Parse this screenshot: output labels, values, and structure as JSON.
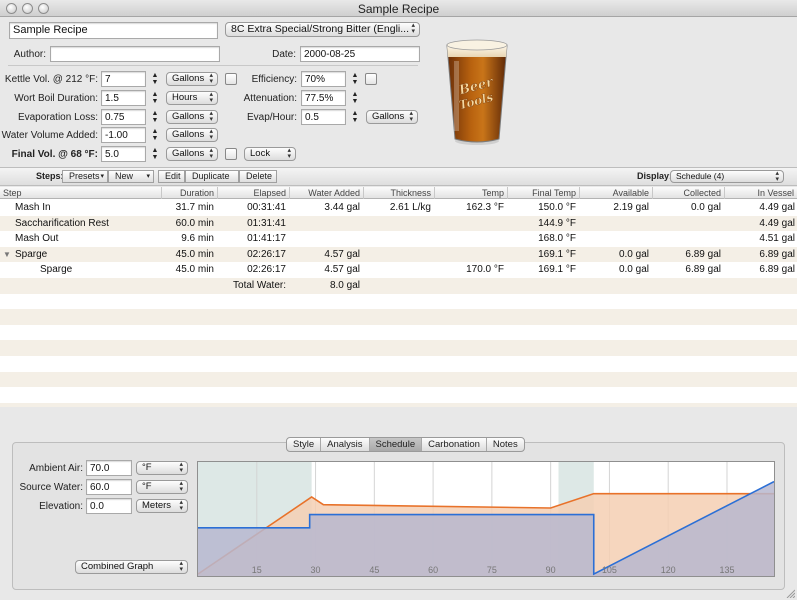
{
  "window": {
    "title": "Sample Recipe"
  },
  "recipe": {
    "name": "Sample Recipe",
    "style": "8C Extra Special/Strong Bitter (Engli...",
    "author_label": "Author:",
    "author": "",
    "date_label": "Date:",
    "date": "2000-08-25"
  },
  "form": {
    "kettle_label": "Kettle Vol. @ 212 °F:",
    "kettle_value": "7",
    "kettle_unit": "Gallons",
    "boil_label": "Wort Boil Duration:",
    "boil_value": "1.5",
    "boil_unit": "Hours",
    "evap_loss_label": "Evaporation Loss:",
    "evap_loss_value": "0.75",
    "evap_loss_unit": "Gallons",
    "water_added_label": "Water Volume Added:",
    "water_added_value": "-1.00",
    "water_added_unit": "Gallons",
    "final_label": "Final Vol. @ 68 °F:",
    "final_value": "5.0",
    "final_unit": "Gallons",
    "lock_label": "Lock",
    "efficiency_label": "Efficiency:",
    "efficiency_value": "70%",
    "attenuation_label": "Attenuation:",
    "attenuation_value": "77.5%",
    "evap_hour_label": "Evap/Hour:",
    "evap_hour_value": "0.5",
    "evap_hour_unit": "Gallons"
  },
  "steps_bar": {
    "steps_label": "Steps:",
    "presets": "Presets",
    "new": "New",
    "edit": "Edit",
    "duplicate": "Duplicate",
    "delete": "Delete",
    "display_label": "Display:",
    "display_value": "Schedule (4)"
  },
  "table": {
    "columns": [
      "Step",
      "Duration",
      "Elapsed",
      "Water Added",
      "Thickness",
      "Temp",
      "Final Temp",
      "Available",
      "Collected",
      "In Vessel"
    ],
    "rows": [
      {
        "step": "Mash In",
        "duration": "31.7 min",
        "elapsed": "00:31:41",
        "water": "3.44 gal",
        "thickness": "2.61 L/kg",
        "temp": "162.3 °F",
        "final": "150.0 °F",
        "available": "2.19 gal",
        "collected": "0.0 gal",
        "vessel": "4.49 gal"
      },
      {
        "step": "Saccharification Rest",
        "duration": "60.0 min",
        "elapsed": "01:31:41",
        "water": "",
        "thickness": "",
        "temp": "",
        "final": "144.9 °F",
        "available": "",
        "collected": "",
        "vessel": "4.49 gal"
      },
      {
        "step": "Mash Out",
        "duration": "9.6 min",
        "elapsed": "01:41:17",
        "water": "",
        "thickness": "",
        "temp": "",
        "final": "168.0 °F",
        "available": "",
        "collected": "",
        "vessel": "4.51 gal"
      },
      {
        "step": "Sparge",
        "duration": "45.0 min",
        "elapsed": "02:26:17",
        "water": "4.57 gal",
        "thickness": "",
        "temp": "",
        "final": "169.1 °F",
        "available": "0.0 gal",
        "collected": "6.89 gal",
        "vessel": "6.89 gal"
      },
      {
        "step": "Sparge",
        "duration": "45.0 min",
        "elapsed": "02:26:17",
        "water": "4.57 gal",
        "thickness": "",
        "temp": "170.0 °F",
        "final": "169.1 °F",
        "available": "0.0 gal",
        "collected": "6.89 gal",
        "vessel": "6.89 gal"
      }
    ],
    "total_label": "Total Water:",
    "total_value": "8.0 gal"
  },
  "tabs": [
    "Style",
    "Analysis",
    "Schedule",
    "Carbonation",
    "Notes"
  ],
  "active_tab": "Schedule",
  "conditions": {
    "ambient_label": "Ambient Air:",
    "ambient_value": "70.0",
    "ambient_unit": "°F",
    "source_label": "Source Water:",
    "source_value": "60.0",
    "source_unit": "°F",
    "elevation_label": "Elevation:",
    "elevation_value": "0.0",
    "elevation_unit": "Meters",
    "graph_mode": "Combined Graph"
  },
  "chart_data": {
    "type": "area",
    "x_ticks": [
      15,
      30,
      45,
      60,
      75,
      90,
      105,
      120,
      135
    ],
    "xlim": [
      0,
      147
    ],
    "colors": {
      "temp": "#e8722a",
      "volume": "#2b6fd6",
      "temp_fill": "#f5cfb3",
      "volume_fill": "#b7b7cf",
      "step_shade": "#dde8e6"
    },
    "temp_line": {
      "x": [
        0,
        29,
        32,
        90,
        101,
        147
      ],
      "y": [
        0,
        0.7,
        0.63,
        0.6,
        0.73,
        0.73
      ]
    },
    "volume_line": {
      "x": [
        0,
        28.5,
        28.5,
        101,
        101,
        147
      ],
      "y": [
        0.42,
        0.42,
        0.54,
        0.54,
        0,
        0.84
      ]
    },
    "shaded_steps": [
      [
        0,
        29
      ],
      [
        92,
        101
      ]
    ]
  }
}
